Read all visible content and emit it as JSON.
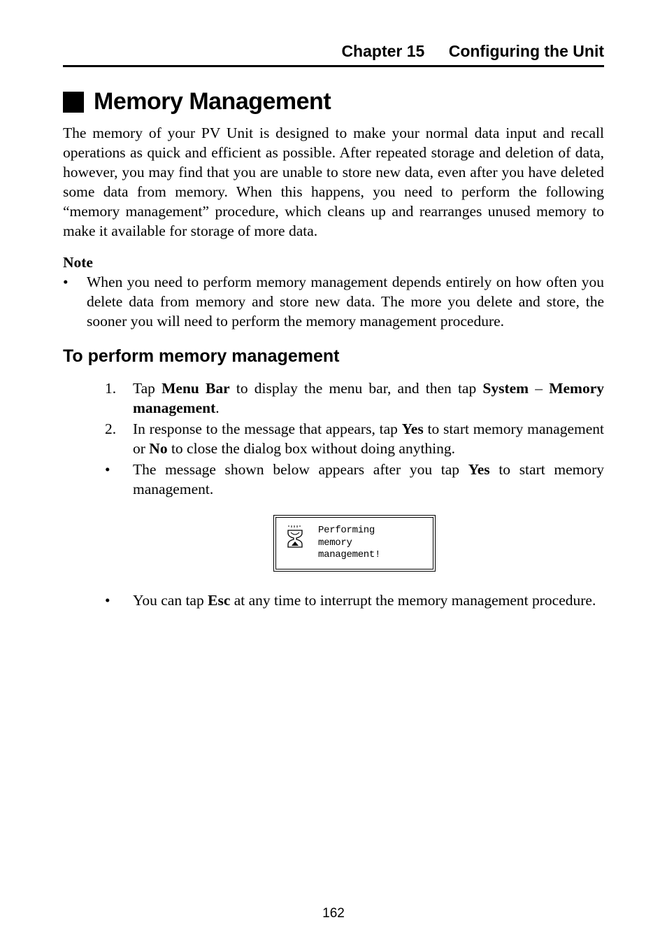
{
  "header": {
    "chapter": "Chapter 15",
    "title": "Configuring the Unit"
  },
  "section": {
    "title": "Memory Management",
    "intro": "The memory of your PV Unit is designed to make your normal data input and recall operations as quick and efficient as possible. After repeated storage and deletion of data, however, you may find that you are unable to store new data, even after you have deleted some data from memory. When this happens, you need to perform the following “memory management” procedure, which cleans up and rearranges unused memory to make it available for storage of more data."
  },
  "note": {
    "label": "Note",
    "items": [
      "When you need to perform memory management depends entirely on how often you delete data from memory and store new data. The more you delete and store, the sooner you will need to perform the memory management procedure."
    ]
  },
  "subsection": {
    "title": "To perform memory management",
    "steps": [
      {
        "num": "1.",
        "before": "Tap ",
        "bold1": "Menu Bar",
        "mid1": " to display the menu bar, and then tap ",
        "bold2": "System",
        "mid2": " – ",
        "bold3": "Memory management",
        "after": "."
      },
      {
        "num": "2.",
        "before": "In response to the message that appears, tap ",
        "bold1": "Yes",
        "mid1": " to start memory management or ",
        "bold2": "No",
        "after": " to close the dialog box without doing anything."
      }
    ],
    "bullets": [
      {
        "before": "The message shown below appears after you tap ",
        "bold1": "Yes",
        "after": " to start memory management."
      },
      {
        "before": "You can tap ",
        "bold1": "Esc",
        "after": " at any time to interrupt the memory management procedure."
      }
    ]
  },
  "dialog": {
    "line1": "Performing",
    "line2": "memory",
    "line3": "management!"
  },
  "page_number": "162"
}
